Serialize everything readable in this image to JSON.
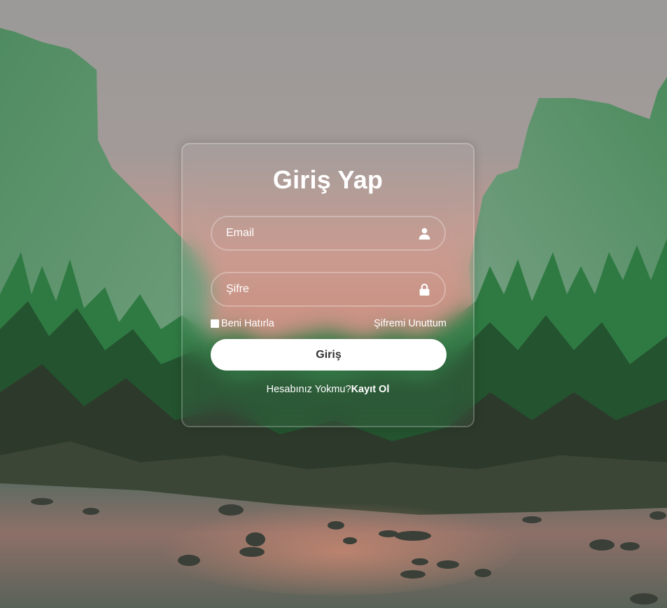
{
  "login": {
    "title": "Giriş Yap",
    "email_placeholder": "Email",
    "password_placeholder": "Şifre",
    "remember_label": "Beni Hatırla",
    "remember_checked": false,
    "forgot_label": "Şifremi Unuttum",
    "submit_label": "Giriş",
    "no_account_text": "Hesabınız Yokmu?",
    "register_label": "Kayıt Ol"
  },
  "icons": {
    "email": "user-icon",
    "password": "lock-icon"
  },
  "colors": {
    "button_bg": "#ffffff",
    "button_text": "#333333",
    "text": "#ffffff"
  }
}
